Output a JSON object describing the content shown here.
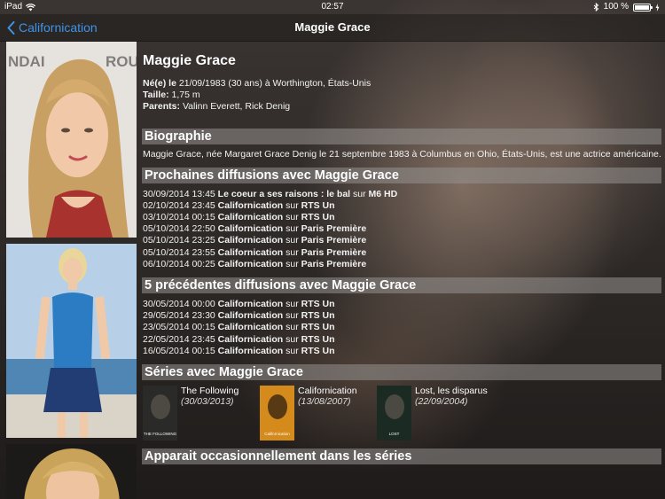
{
  "status": {
    "device": "iPad",
    "time": "02:57",
    "battery": "100 %"
  },
  "nav": {
    "back_label": "Californication",
    "title": "Maggie Grace"
  },
  "person": {
    "name": "Maggie Grace",
    "born_label": "Né(e) le",
    "born_value": "21/09/1983 (30 ans) à Worthington, États-Unis",
    "height_label": "Taille:",
    "height_value": "1,75 m",
    "parents_label": "Parents:",
    "parents_value": "Valinn Everett, Rick Denig"
  },
  "biography": {
    "header": "Biographie",
    "text": "Maggie Grace, née Margaret Grace Denig le 21 septembre 1983 à Columbus en Ohio, États-Unis, est une actrice américaine."
  },
  "upcoming": {
    "header": "Prochaines diffusions avec Maggie Grace",
    "rows": [
      {
        "datetime": "30/09/2014 13:45",
        "title": "Le coeur a ses raisons : le bal",
        "sep": "sur",
        "channel": "M6 HD"
      },
      {
        "datetime": "02/10/2014 23:45",
        "title": "Californication",
        "sep": "sur",
        "channel": "RTS Un"
      },
      {
        "datetime": "03/10/2014 00:15",
        "title": "Californication",
        "sep": "sur",
        "channel": "RTS Un"
      },
      {
        "datetime": "05/10/2014 22:50",
        "title": "Californication",
        "sep": "sur",
        "channel": "Paris Première"
      },
      {
        "datetime": "05/10/2014 23:25",
        "title": "Californication",
        "sep": "sur",
        "channel": "Paris Première"
      },
      {
        "datetime": "05/10/2014 23:55",
        "title": "Californication",
        "sep": "sur",
        "channel": "Paris Première"
      },
      {
        "datetime": "06/10/2014 00:25",
        "title": "Californication",
        "sep": "sur",
        "channel": "Paris Première"
      }
    ]
  },
  "previous": {
    "header": "5 précédentes diffusions avec Maggie Grace",
    "rows": [
      {
        "datetime": "30/05/2014 00:00",
        "title": "Californication",
        "sep": "sur",
        "channel": "RTS Un"
      },
      {
        "datetime": "29/05/2014 23:30",
        "title": "Californication",
        "sep": "sur",
        "channel": "RTS Un"
      },
      {
        "datetime": "23/05/2014 00:15",
        "title": "Californication",
        "sep": "sur",
        "channel": "RTS Un"
      },
      {
        "datetime": "22/05/2014 23:45",
        "title": "Californication",
        "sep": "sur",
        "channel": "RTS Un"
      },
      {
        "datetime": "16/05/2014 00:15",
        "title": "Californication",
        "sep": "sur",
        "channel": "RTS Un"
      }
    ]
  },
  "series": {
    "header": "Séries avec Maggie Grace",
    "items": [
      {
        "title": "The Following",
        "date": "(30/03/2013)",
        "poster_text": "THE FOLLOWING",
        "poster_color": "#2a2a28"
      },
      {
        "title": "Californication",
        "date": "(13/08/2007)",
        "poster_text": "Californication",
        "poster_color": "#d48b1c"
      },
      {
        "title": "Lost, les disparus",
        "date": "(22/09/2004)",
        "poster_text": "LOST",
        "poster_color": "#1c2a24"
      }
    ]
  },
  "occasional": {
    "header": "Apparait occasionnellement dans les séries"
  }
}
